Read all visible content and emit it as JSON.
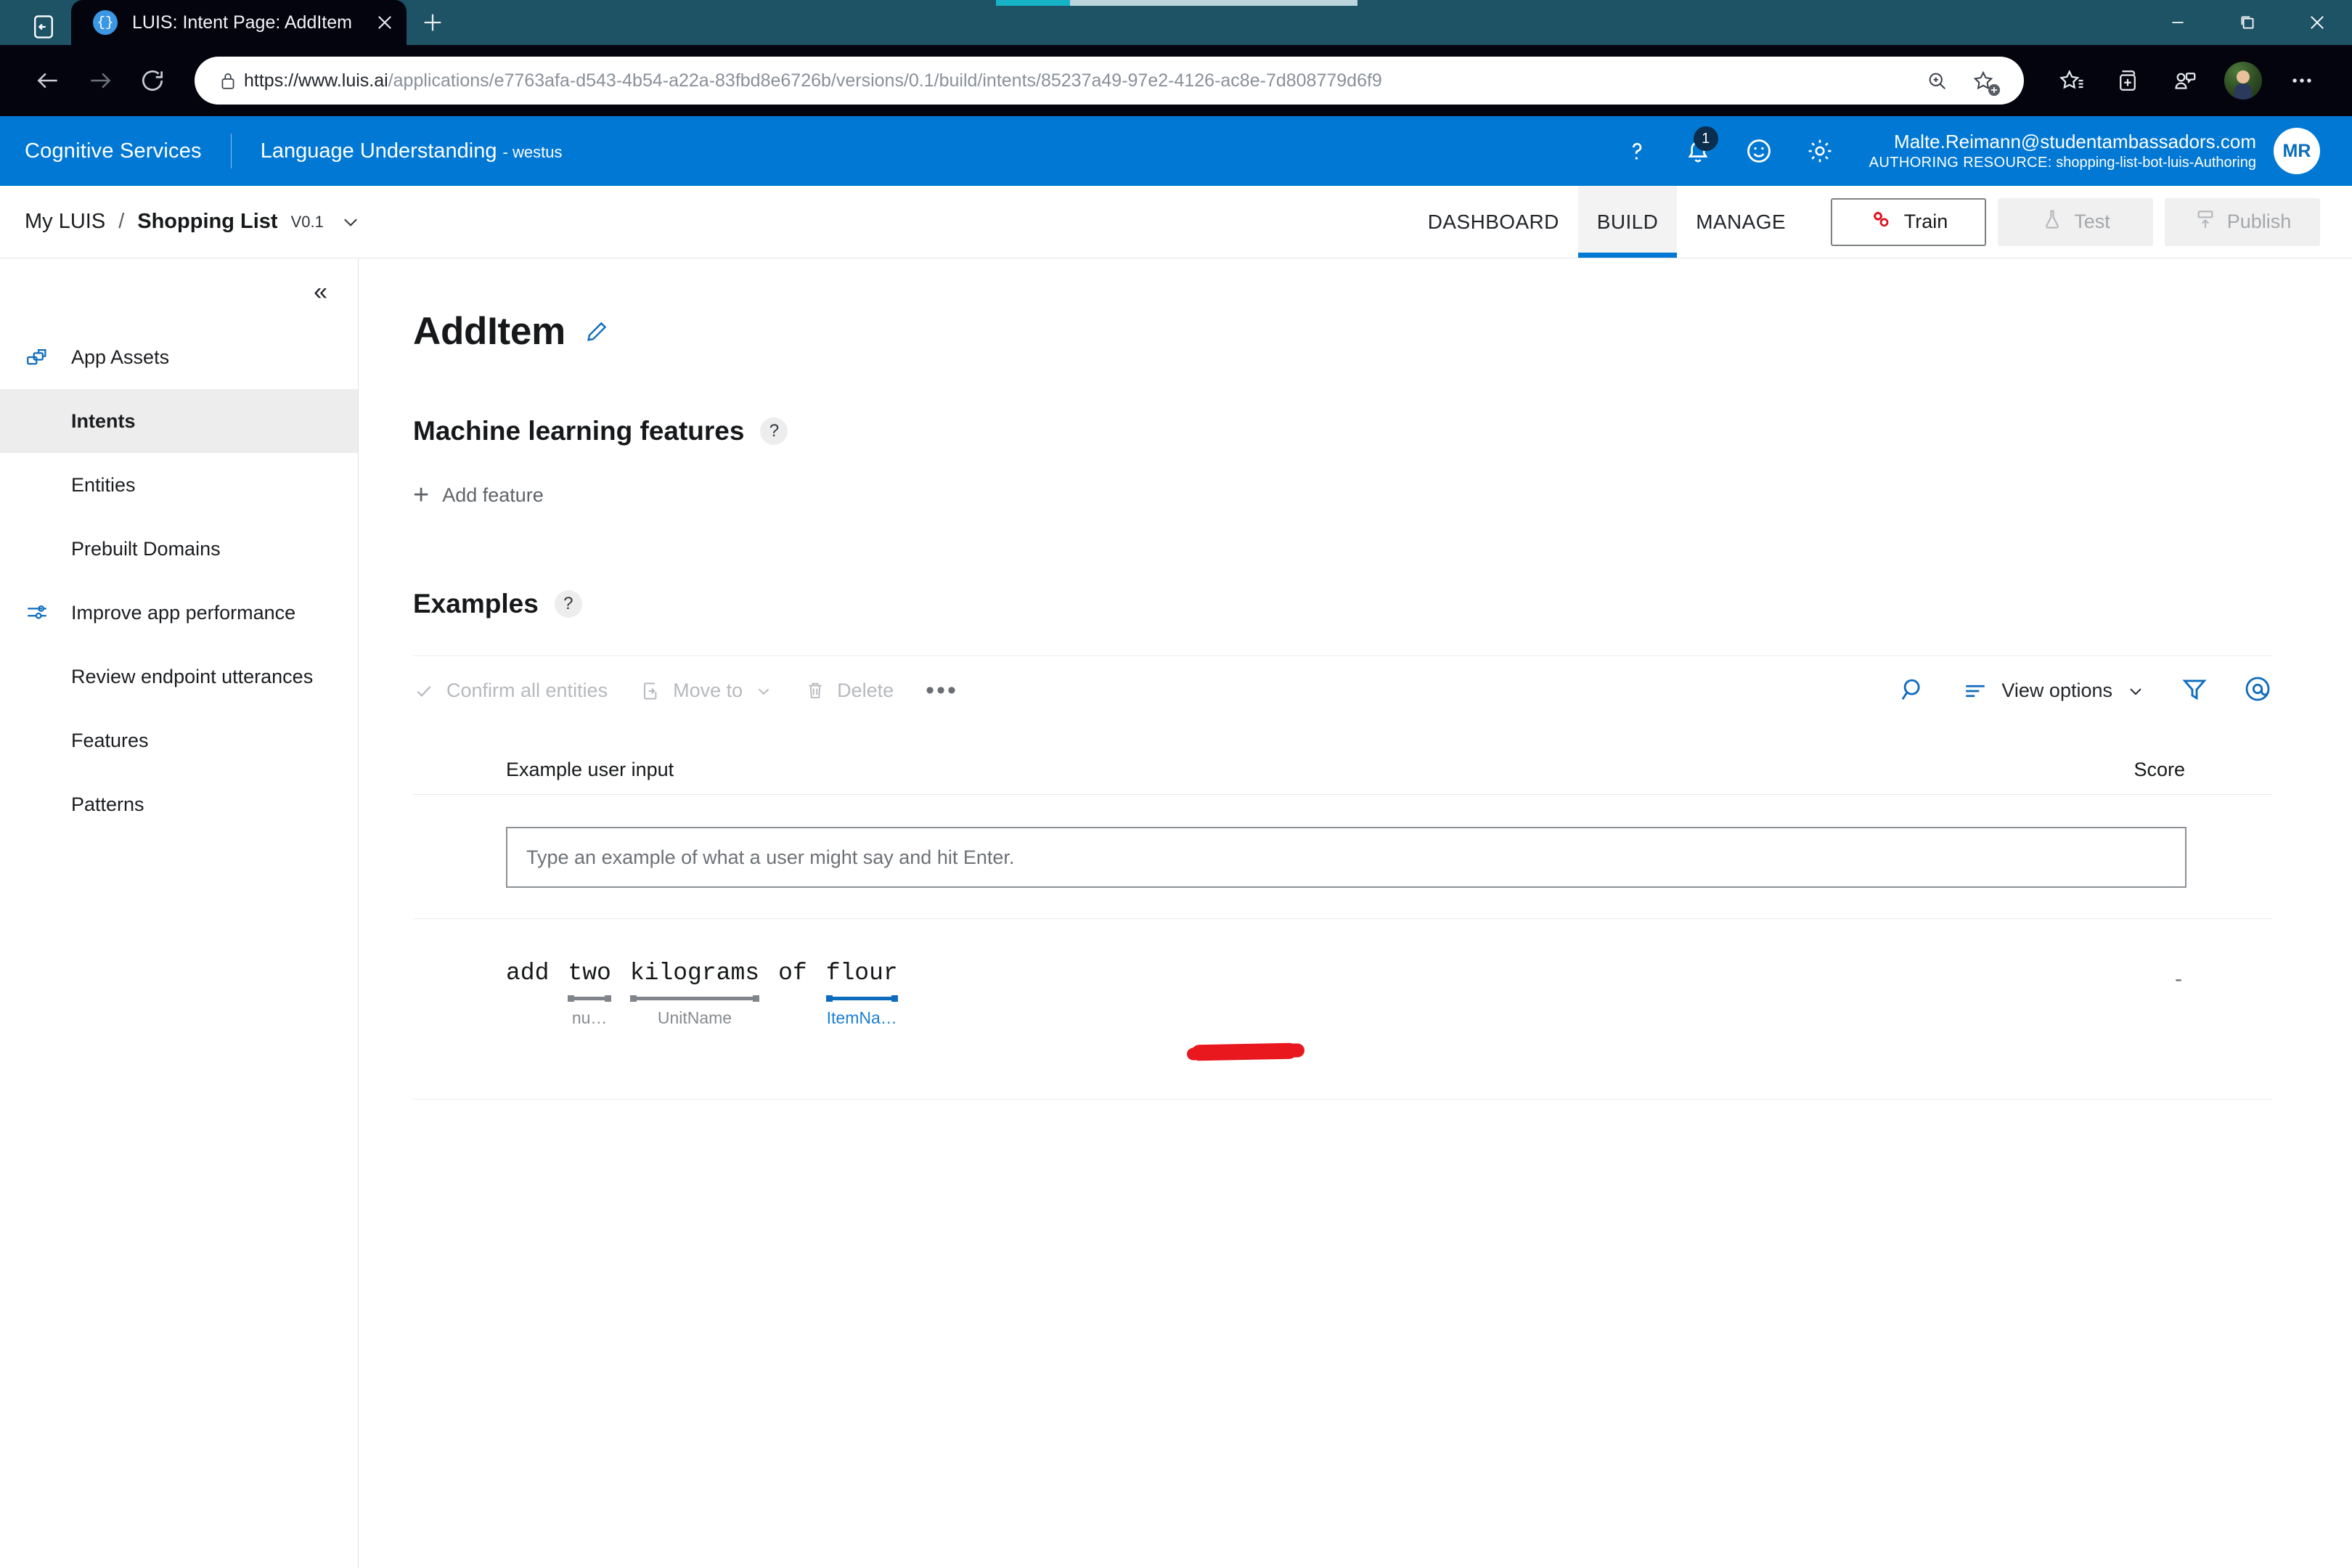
{
  "browser": {
    "tab": {
      "title": "LUIS: Intent Page: AddItem",
      "favicon_glyph": "{}",
      "close_label": "×"
    },
    "newtab_label": "+",
    "url": {
      "scheme_host": "https://www.luis.ai",
      "path": "/applications/e7763afa-d543-4b54-a22a-83fbd8e6726b/versions/0.1/build/intents/85237a49-97e2-4126-ac8e-7d808779d6f9"
    },
    "window": {
      "minimize": "—",
      "restore": "❐",
      "close": "✕"
    },
    "chrome_color": "#1d5365",
    "progress_color": "#16b3c6"
  },
  "header": {
    "service": "Cognitive Services",
    "product": "Language Understanding",
    "region": "- westus",
    "notification_count": "1",
    "user_email": "Malte.Reimann@studentambassadors.com",
    "authoring_label": "AUTHORING RESOURCE:",
    "authoring_resource": "shopping-list-bot-luis-Authoring",
    "user_initials": "MR",
    "accent_color": "#0078d4"
  },
  "appnav": {
    "crumb_root": "My LUIS",
    "crumb_sep": "/",
    "app_name": "Shopping List",
    "version": "V0.1",
    "tabs": [
      {
        "label": "DASHBOARD",
        "active": false
      },
      {
        "label": "BUILD",
        "active": true
      },
      {
        "label": "MANAGE",
        "active": false
      }
    ],
    "train_label": "Train",
    "test_label": "Test",
    "publish_label": "Publish"
  },
  "sidebar": {
    "collapse_label": "«",
    "items": [
      {
        "label": "App Assets",
        "icon": "app-assets-icon",
        "active": false,
        "has_icon": true
      },
      {
        "label": "Intents",
        "icon": "",
        "active": true,
        "has_icon": false
      },
      {
        "label": "Entities",
        "icon": "",
        "active": false,
        "has_icon": false
      },
      {
        "label": "Prebuilt Domains",
        "icon": "",
        "active": false,
        "has_icon": false
      },
      {
        "label": "Improve app performance",
        "icon": "improve-perf-icon",
        "active": false,
        "has_icon": true
      },
      {
        "label": "Review endpoint utterances",
        "icon": "",
        "active": false,
        "has_icon": false
      },
      {
        "label": "Features",
        "icon": "",
        "active": false,
        "has_icon": false
      },
      {
        "label": "Patterns",
        "icon": "",
        "active": false,
        "has_icon": false
      }
    ]
  },
  "main": {
    "page_title": "AddItem",
    "ml_features": {
      "title": "Machine learning features",
      "help": "?",
      "add_feature": "Add feature",
      "plus": "+"
    },
    "examples": {
      "title": "Examples",
      "help": "?",
      "toolbar": {
        "confirm_all": "Confirm all entities",
        "move_to": "Move to",
        "delete": "Delete",
        "overflow": "•••",
        "view_options": "View options"
      },
      "columns": {
        "input": "Example user input",
        "score": "Score"
      },
      "new_utterance_placeholder": "Type an example of what a user might say and hit Enter.",
      "rows": [
        {
          "tokens": [
            {
              "text": "add",
              "entity": null,
              "color": null
            },
            {
              "text": "two",
              "entity": "nu…",
              "color": "gray"
            },
            {
              "text": "kilograms",
              "entity": "UnitName",
              "color": "gray"
            },
            {
              "text": "of",
              "entity": null,
              "color": null
            },
            {
              "text": "flour",
              "entity": "ItemNa…",
              "color": "blue"
            }
          ],
          "score": "-",
          "annotation": {
            "type": "red-underline",
            "color": "#e8181e",
            "under_token": "flour"
          }
        }
      ]
    }
  }
}
